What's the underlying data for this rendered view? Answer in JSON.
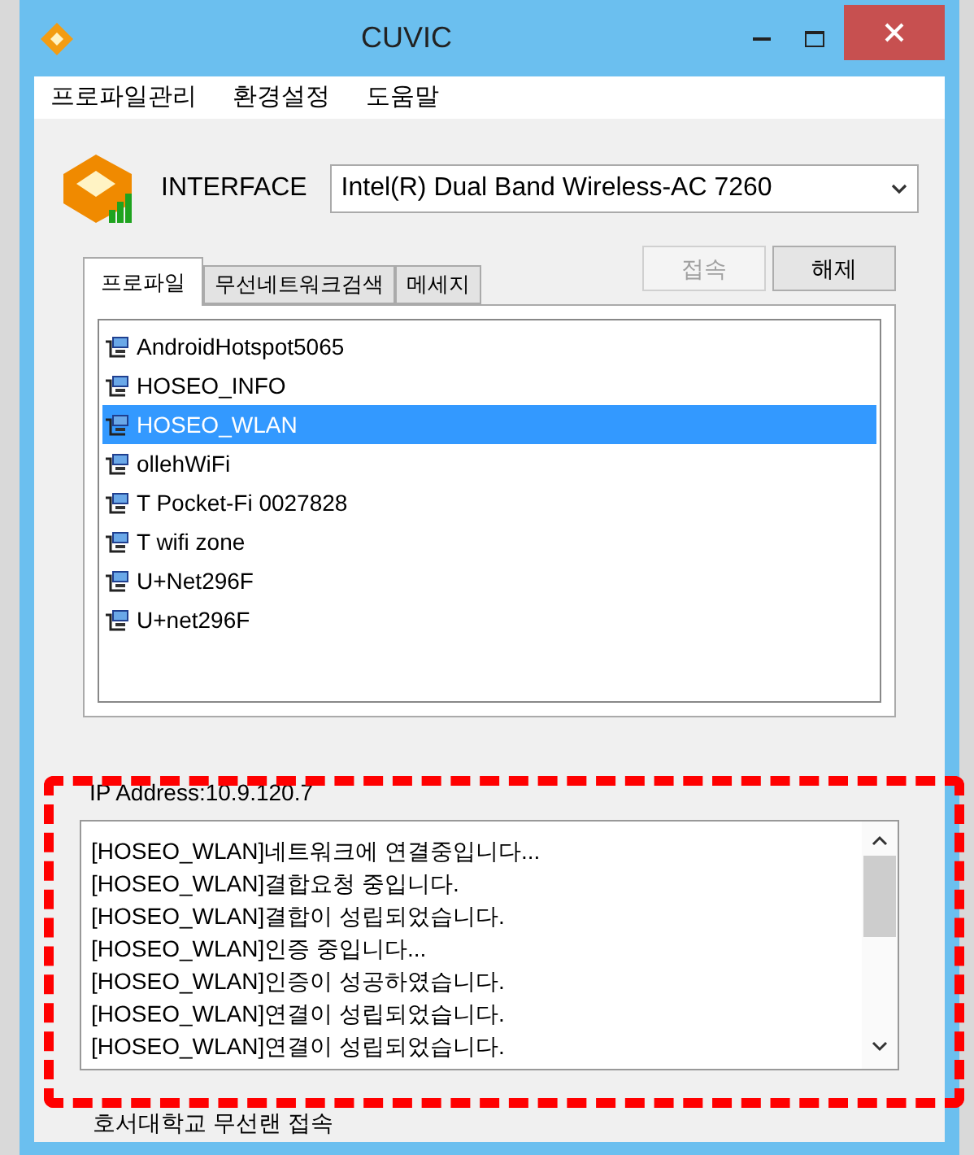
{
  "window": {
    "title": "CUVIC"
  },
  "menu": [
    "프로파일관리",
    "환경설정",
    "도움말"
  ],
  "interface": {
    "label": "INTERFACE",
    "value": "Intel(R) Dual Band Wireless-AC 7260"
  },
  "buttons": [
    {
      "label": "접속",
      "disabled": true
    },
    {
      "label": "해제",
      "disabled": false
    }
  ],
  "tabs": [
    {
      "label": "프로파일",
      "selected": true
    },
    {
      "label": "무선네트워크검색",
      "selected": false
    },
    {
      "label": "메세지",
      "selected": false
    }
  ],
  "networks": [
    {
      "name": "AndroidHotspot5065",
      "selected": false
    },
    {
      "name": "HOSEO_INFO",
      "selected": false
    },
    {
      "name": "HOSEO_WLAN",
      "selected": true
    },
    {
      "name": "ollehWiFi",
      "selected": false
    },
    {
      "name": "T Pocket-Fi 0027828",
      "selected": false
    },
    {
      "name": "T wifi zone",
      "selected": false
    },
    {
      "name": "U+Net296F",
      "selected": false
    },
    {
      "name": "U+net296F",
      "selected": false
    }
  ],
  "ip_address": "IP Address:10.9.120.7",
  "log": [
    "[HOSEO_WLAN]네트워크에 연결중입니다...",
    "[HOSEO_WLAN]결합요청 중입니다.",
    "[HOSEO_WLAN]결합이 성립되었습니다.",
    "[HOSEO_WLAN]인증 중입니다...",
    "[HOSEO_WLAN]인증이 성공하였습니다.",
    "[HOSEO_WLAN]연결이 성립되었습니다.",
    "[HOSEO_WLAN]연결이 성립되었습니다."
  ],
  "status_bar": "호서대학교 무선랜 접속"
}
